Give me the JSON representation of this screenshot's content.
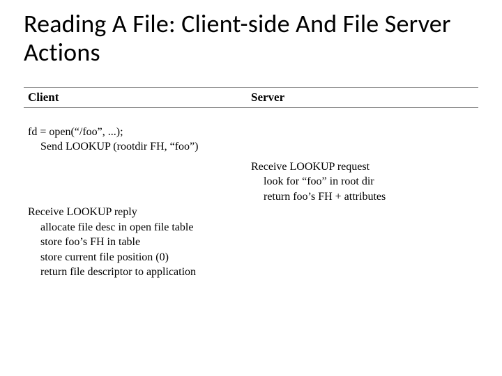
{
  "title": "Reading A File: Client-side And File Server Actions",
  "columns": {
    "client": "Client",
    "server": "Server"
  },
  "client": {
    "block1": {
      "l1": "fd = open(“/foo”, ...);",
      "l2": "Send LOOKUP (rootdir FH, “foo”)"
    },
    "block2": {
      "l1": "Receive LOOKUP reply",
      "l2": "allocate file desc in open file table",
      "l3": "store foo’s FH in table",
      "l4": "store current file position (0)",
      "l5": "return file descriptor to application"
    }
  },
  "server": {
    "block1": {
      "l1": "Receive LOOKUP request",
      "l2": "look for “foo” in root dir",
      "l3": "return foo’s FH + attributes"
    }
  }
}
